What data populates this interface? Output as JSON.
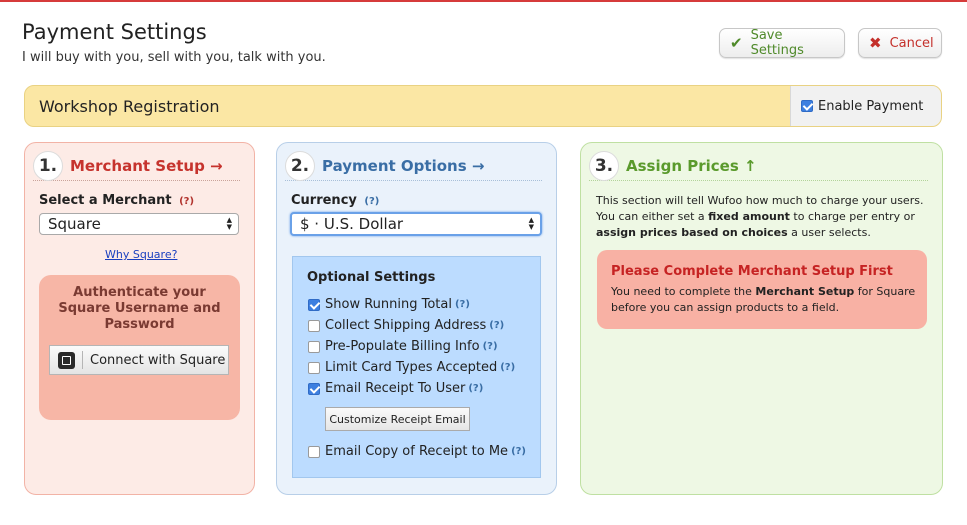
{
  "header": {
    "title": "Payment Settings",
    "subtitle": "I will buy with you, sell with you, talk with you.",
    "save_label": "Save Settings",
    "cancel_label": "Cancel"
  },
  "form_bar": {
    "form_name": "Workshop Registration",
    "enable_label": "Enable Payment",
    "enable_checked": true
  },
  "step1": {
    "number": "1.",
    "title": "Merchant Setup →",
    "select_label": "Select a Merchant",
    "help": "(?)",
    "merchant_value": "Square",
    "why_link": "Why Square?",
    "auth_text": "Authenticate your Square Username and Password",
    "connect_label": "Connect with Square"
  },
  "step2": {
    "number": "2.",
    "title": "Payment Options →",
    "currency_label": "Currency",
    "help": "(?)",
    "currency_value": "$ · U.S. Dollar",
    "optional_title": "Optional Settings",
    "options": [
      {
        "label": "Show Running Total",
        "checked": true,
        "help": "(?)"
      },
      {
        "label": "Collect Shipping Address",
        "checked": false,
        "help": "(?)"
      },
      {
        "label": "Pre-Populate Billing Info",
        "checked": false,
        "help": "(?)"
      },
      {
        "label": "Limit Card Types Accepted",
        "checked": false,
        "help": "(?)"
      },
      {
        "label": "Email Receipt To User",
        "checked": true,
        "help": "(?)"
      },
      {
        "label": "Email Copy of Receipt to Me",
        "checked": false,
        "help": "(?)"
      }
    ],
    "customize_label": "Customize Receipt Email"
  },
  "step3": {
    "number": "3.",
    "title": "Assign Prices ↑",
    "desc_1": "This section will tell Wufoo how much to charge your users. You can either set a ",
    "desc_bold_1": "fixed amount",
    "desc_2": " to charge per entry or ",
    "desc_bold_2": "assign prices based on choices",
    "desc_3": " a user selects.",
    "alert_title": "Please Complete Merchant Setup First",
    "alert_1": "You need to complete the ",
    "alert_bold": "Merchant Setup",
    "alert_2": " for Square before you can assign products to a field."
  },
  "colors": {
    "accent_red": "#c6332d",
    "accent_blue": "#3a6ea5",
    "accent_green": "#5a9a2c",
    "bar_yellow": "#fbe7a4"
  }
}
